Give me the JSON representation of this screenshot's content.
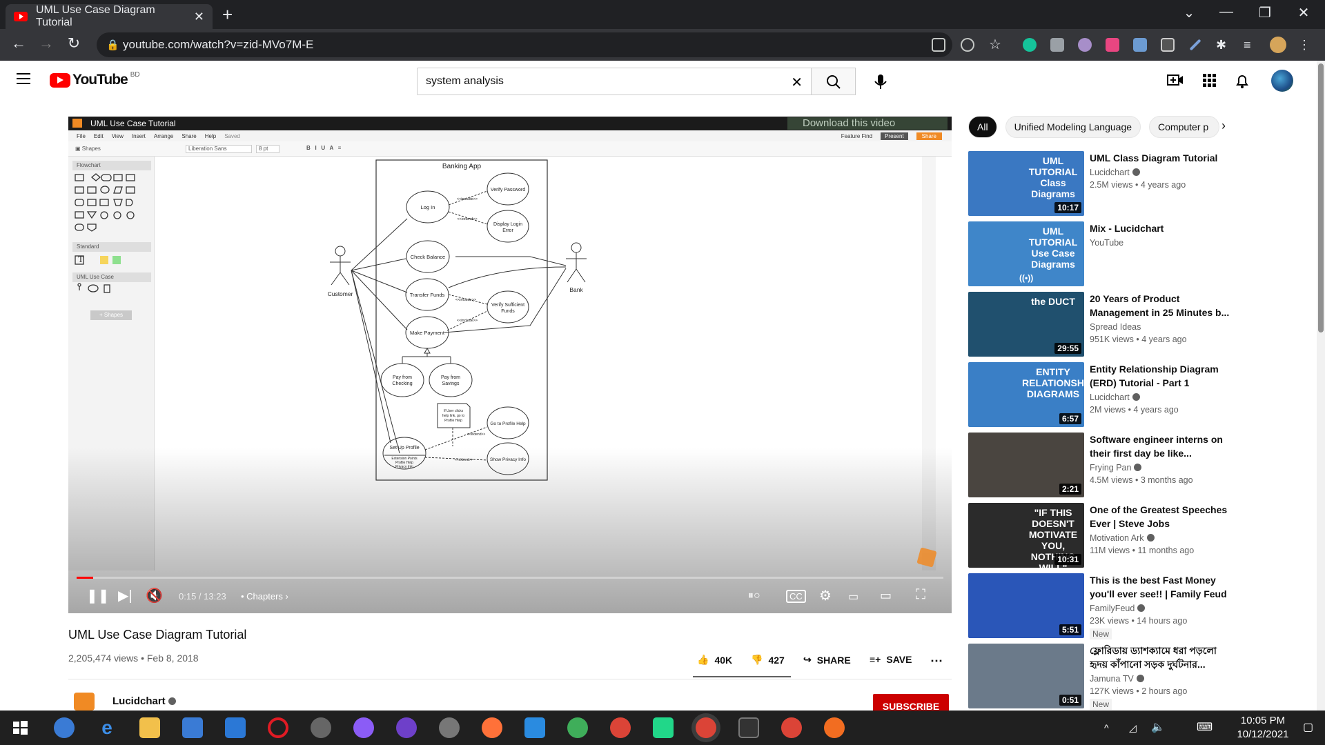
{
  "browser": {
    "tab_title": "UML Use Case Diagram Tutorial",
    "url": "youtube.com/watch?v=zid-MVo7M-E"
  },
  "youtube": {
    "region": "BD",
    "logo_text": "YouTube",
    "search_value": "system analysis"
  },
  "player": {
    "app_title": "UML Use Case Tutorial",
    "download_banner": "Download this video",
    "menu": [
      "File",
      "Edit",
      "View",
      "Insert",
      "Arrange",
      "Share",
      "Help",
      "Saved"
    ],
    "font_name": "Liberation Sans",
    "font_size": "8 pt",
    "feature_find": "Feature Find",
    "present": "Present",
    "share": "Share",
    "panels": {
      "flowchart": "Flowchart",
      "standard": "Standard",
      "uml": "UML Use Case",
      "more_shapes": "+ Shapes"
    },
    "time": "0:15 / 13:23",
    "chapters": "Chapters",
    "progress": 0.019
  },
  "diagram": {
    "system": "Banking App",
    "actors": {
      "customer": "Customer",
      "bank": "Bank"
    },
    "use_cases": {
      "login": "Log In",
      "verify_password": "Verify Password",
      "display_error": [
        "Display Login",
        "Error"
      ],
      "check_balance": "Check Balance",
      "transfer": "Transfer Funds",
      "verify_funds": [
        "Verify Sufficient",
        "Funds"
      ],
      "make_payment": "Make Payment",
      "pay_checking": [
        "Pay from",
        "Checking"
      ],
      "pay_savings": [
        "Pay from",
        "Savings"
      ],
      "profile_help": "Go to Profile Help",
      "setup_profile": "Set Up Profile",
      "extension_points": [
        "Extension Points",
        "Profile Help",
        "Privacy Info"
      ],
      "privacy": "Show Privacy Info"
    },
    "relations": {
      "include": "<<include>>",
      "extend": "<<extend>>"
    },
    "note": [
      "If User clicks",
      "help link, go to",
      "Profile Help"
    ]
  },
  "video": {
    "title": "UML Use Case Diagram Tutorial",
    "meta": "2,205,474 views • Feb 8, 2018",
    "likes": "40K",
    "dislikes": "427",
    "share": "SHARE",
    "save": "SAVE",
    "channel": "Lucidchart",
    "subscribe": "SUBSCRIBE"
  },
  "chips": [
    "All",
    "Unified Modeling Language",
    "Computer p"
  ],
  "recommendations": [
    {
      "title": "UML Class Diagram Tutorial",
      "channel": "Lucidchart",
      "verified": true,
      "meta": "2.5M views • 4 years ago",
      "duration": "10:17",
      "thumb_text": "UML TUTORIAL Class Diagrams",
      "color": "#3a78c2"
    },
    {
      "title": "Mix - Lucidchart",
      "channel": "YouTube",
      "verified": false,
      "meta": "",
      "duration": "",
      "thumb_text": "UML TUTORIAL Use Case Diagrams",
      "color": "#3f86c9"
    },
    {
      "title": "20 Years of Product Management in 25 Minutes b...",
      "channel": "Spread Ideas",
      "verified": false,
      "meta": "951K views • 4 years ago",
      "duration": "29:55",
      "thumb_text": "the DUCT",
      "color": "#20506e"
    },
    {
      "title": "Entity Relationship Diagram (ERD) Tutorial - Part 1",
      "channel": "Lucidchart",
      "verified": true,
      "meta": "2M views • 4 years ago",
      "duration": "6:57",
      "thumb_text": "ENTITY RELATIONSHIP DIAGRAMS",
      "color": "#3a7fc6"
    },
    {
      "title": "Software engineer interns on their first day be like...",
      "channel": "Frying Pan",
      "verified": true,
      "meta": "4.5M views • 3 months ago",
      "duration": "2:21",
      "thumb_text": "",
      "color": "#4a4540"
    },
    {
      "title": "One of the Greatest Speeches Ever | Steve Jobs",
      "channel": "Motivation Ark",
      "verified": true,
      "meta": "11M views • 11 months ago",
      "duration": "10:31",
      "thumb_text": "\"IF THIS DOESN'T MOTIVATE YOU, NOTHING WILL\"",
      "color": "#2b2b2b"
    },
    {
      "title": "This is the best Fast Money you'll ever see!! | Family Feud",
      "channel": "FamilyFeud",
      "verified": true,
      "meta": "23K views • 14 hours ago",
      "duration": "5:51",
      "thumb_text": "",
      "color": "#2a56b8",
      "badge": "New"
    },
    {
      "title": "ফ্লোরিডায় ড্যাশক্যামে ধরা পড়লো হৃদয় কাঁপানো সড়ক দুর্ঘটনার...",
      "channel": "Jamuna TV",
      "verified": true,
      "meta": "127K views • 2 hours ago",
      "duration": "0:51",
      "thumb_text": "",
      "color": "#6b7a8a",
      "badge": "New"
    }
  ],
  "taskbar": {
    "time": "10:05 PM",
    "date": "10/12/2021"
  }
}
